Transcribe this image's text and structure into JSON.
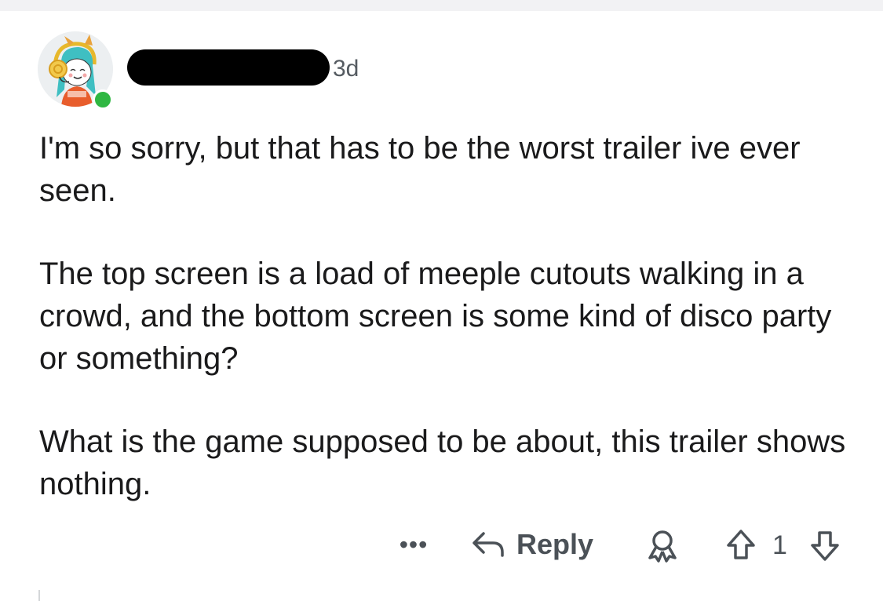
{
  "comment": {
    "timestamp": "3d",
    "paragraphs": [
      "I'm so sorry, but that has to be the worst trailer ive ever seen.",
      "The top screen is a load of meeple cutouts walking in a crowd, and the bottom screen is some kind of disco party or something?",
      "What is the game supposed to be about, this trailer shows nothing."
    ],
    "online_status_color": "#2fb742"
  },
  "actions": {
    "more_label": "•••",
    "reply_label": "Reply",
    "vote_count": "1",
    "icons": {
      "reply": "reply-arrow-icon",
      "award": "award-icon",
      "upvote": "upvote-arrow-icon",
      "downvote": "downvote-arrow-icon"
    }
  }
}
